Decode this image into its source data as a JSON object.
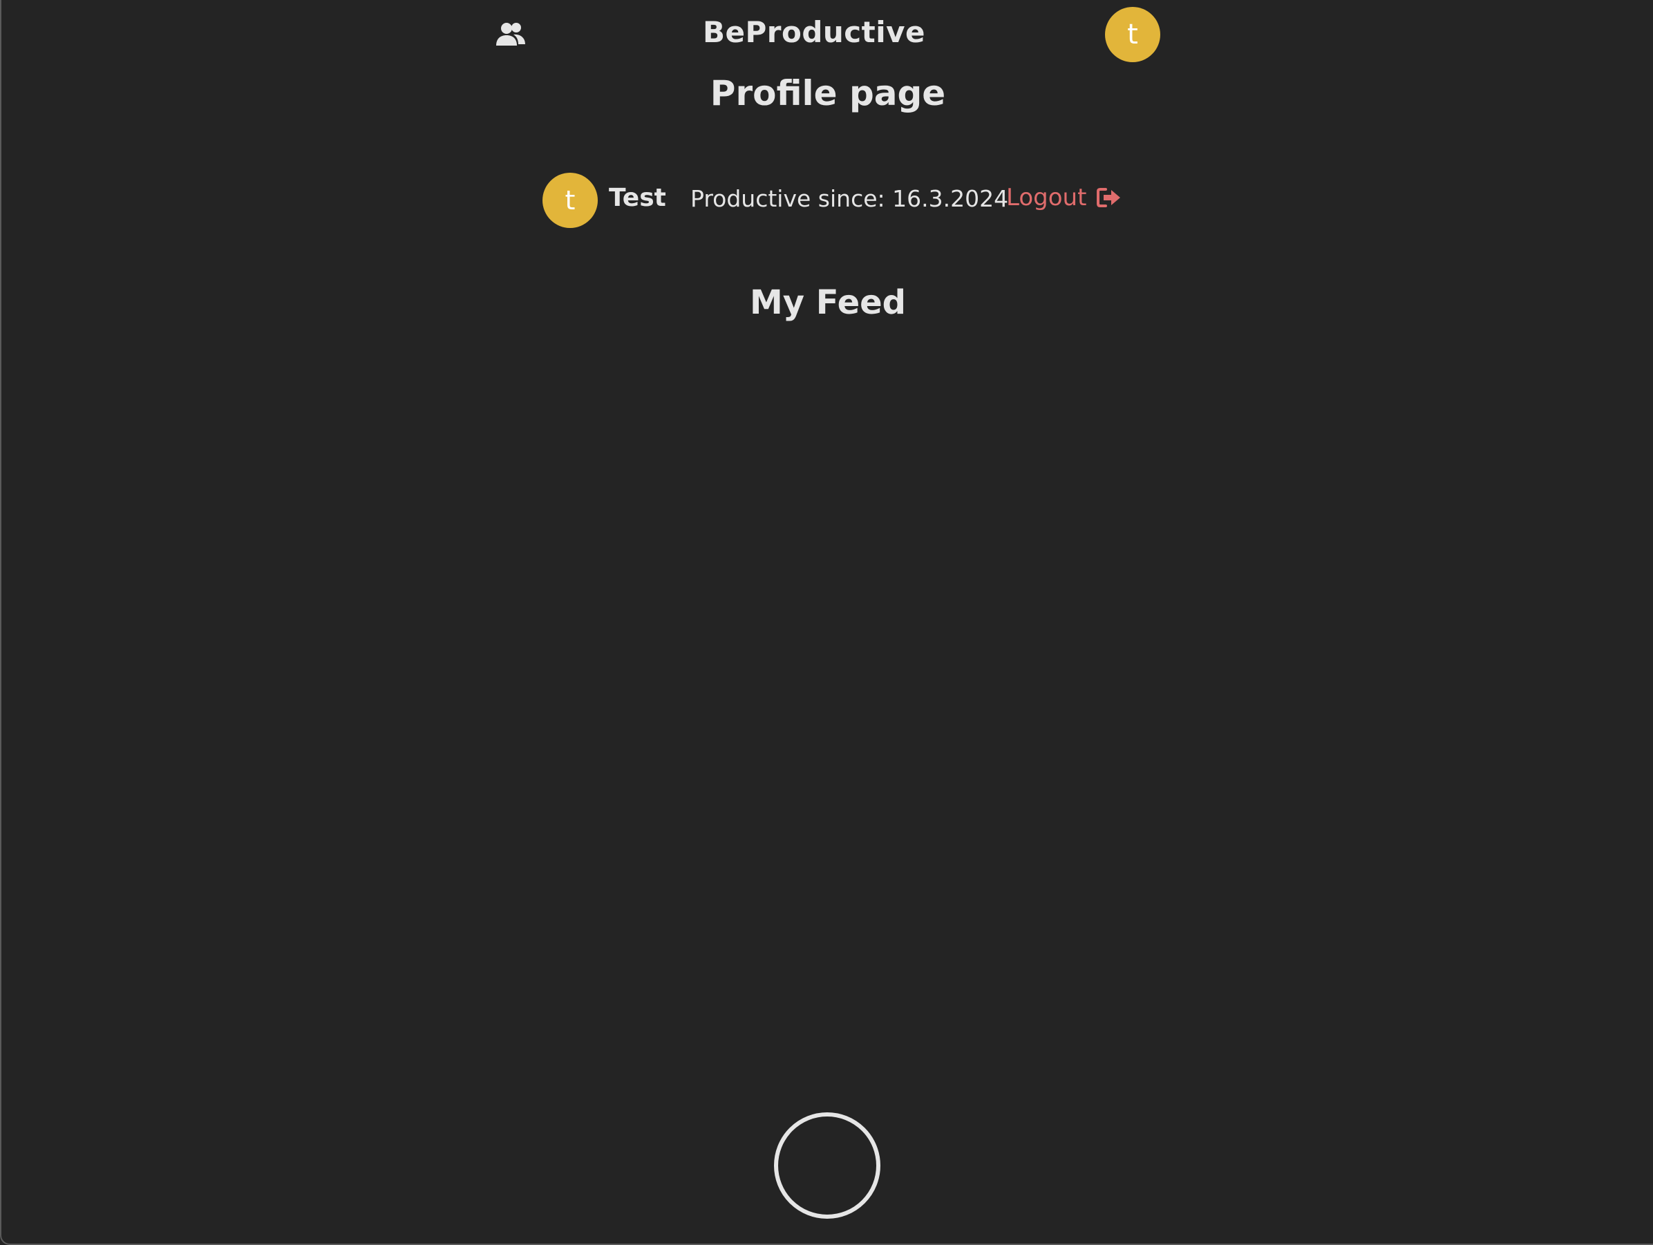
{
  "header": {
    "brand": "BeProductive",
    "friends_icon": "users-icon",
    "avatar_initial": "t"
  },
  "page": {
    "title": "Profile page"
  },
  "profile": {
    "avatar_initial": "t",
    "name": "Test",
    "since_text": "Productive since: 16.3.2024",
    "logout_label": "Logout",
    "logout_icon": "sign-out-icon"
  },
  "feed": {
    "title": "My Feed",
    "items": []
  },
  "action_button": {
    "icon": "circle-button"
  },
  "colors": {
    "background": "#242424",
    "text": "#e6e6e6",
    "avatar": "#e2b53a",
    "logout": "#e06c6c"
  }
}
